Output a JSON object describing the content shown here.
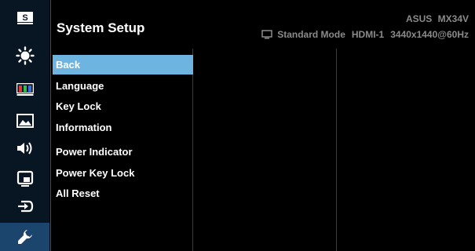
{
  "header": {
    "title": "System Setup",
    "model": "ASUS  MX34V",
    "status": {
      "mode": "Standard Mode",
      "input": "HDMI-1",
      "resolution": "3440x1440@60Hz",
      "icon": "monitor-icon"
    }
  },
  "sidebar": {
    "items": [
      {
        "icon": "splendid-s-icon",
        "active": false
      },
      {
        "icon": "bluelight-icon",
        "active": false
      },
      {
        "icon": "color-bars-icon",
        "active": false
      },
      {
        "icon": "image-icon",
        "active": false
      },
      {
        "icon": "sound-icon",
        "active": false
      },
      {
        "icon": "pip-icon",
        "active": false
      },
      {
        "icon": "input-select-icon",
        "active": false
      },
      {
        "icon": "wrench-icon",
        "active": true
      }
    ]
  },
  "menu": {
    "items": [
      {
        "label": "Back",
        "selected": true
      },
      {
        "label": "Language",
        "selected": false
      },
      {
        "label": "Key Lock",
        "selected": false
      },
      {
        "label": "Information",
        "selected": false
      },
      {
        "label": "Power Indicator",
        "selected": false
      },
      {
        "label": "Power Key Lock",
        "selected": false
      },
      {
        "label": "All Reset",
        "selected": false
      }
    ]
  },
  "colors": {
    "selected_bg": "#6db4e0",
    "rail_bg": "#081522",
    "rail_active_bg": "#1b456d",
    "status_text": "#8a8a8a"
  }
}
